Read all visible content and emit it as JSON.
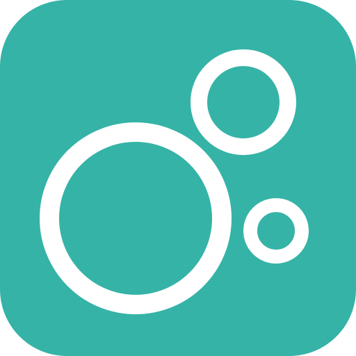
{
  "app_icon": {
    "icon_name": "bubbles-icon",
    "colors": {
      "background": "#35B3A7",
      "ring": "#FFFFFF"
    }
  }
}
